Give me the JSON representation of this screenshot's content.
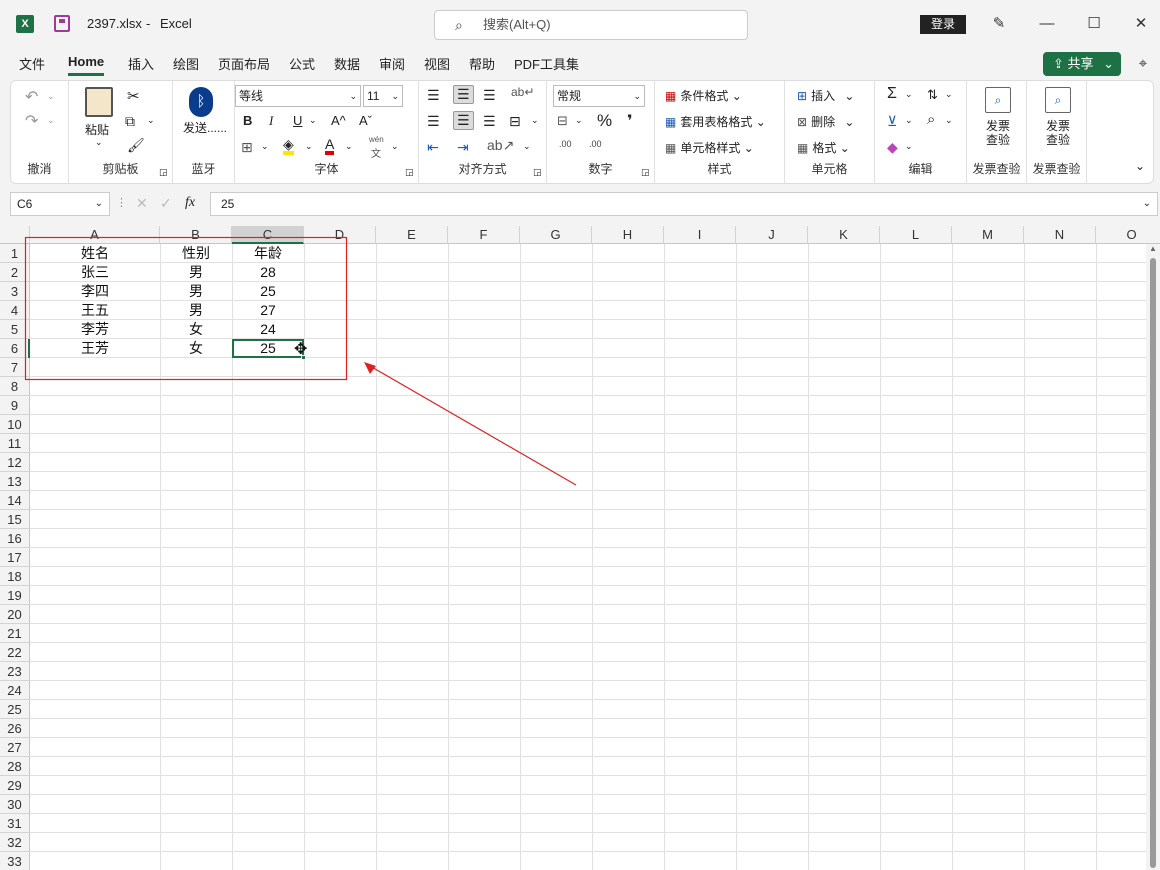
{
  "window": {
    "filename": "2397.xlsx",
    "sep": "-",
    "app": "Excel",
    "search_placeholder": "搜索(Alt+Q)",
    "login": "登录"
  },
  "menu": [
    "文件",
    "Home",
    "插入",
    "绘图",
    "页面布局",
    "公式",
    "数据",
    "审阅",
    "视图",
    "帮助",
    "PDF工具集"
  ],
  "share": "共享",
  "ribbon": {
    "undo_label": "撤消",
    "clipboard": {
      "paste": "粘贴",
      "label": "剪贴板"
    },
    "bluetooth": {
      "btn": "发送......",
      "label": "蓝牙"
    },
    "font": {
      "name": "等线",
      "size": "11",
      "bold": "B",
      "italic": "I",
      "underline": "U",
      "grow": "A^",
      "shrink": "Aˇ",
      "wen_top": "wén",
      "wen": "文",
      "label": "字体"
    },
    "align": {
      "label": "对齐方式"
    },
    "number": {
      "format": "常规",
      "percent": "%",
      "comma": "❜",
      "dec_inc": ".00",
      "dec_dec": ".00",
      "label": "数字"
    },
    "styles": {
      "cond": "条件格式",
      "table": "套用表格格式",
      "cell": "单元格样式",
      "label": "样式"
    },
    "cells": {
      "insert": "插入",
      "delete": "删除",
      "format": "格式",
      "label": "单元格"
    },
    "edit": {
      "sum": "Σ",
      "label": "编辑"
    },
    "invoice1": {
      "btn": "发票查验",
      "label": "发票查验"
    },
    "invoice2": {
      "btn": "发票查验",
      "label": "发票查验"
    }
  },
  "namebox": "C6",
  "fx": "fx",
  "formula": "25",
  "columns": [
    "A",
    "B",
    "C",
    "D",
    "E",
    "F",
    "G",
    "H",
    "I",
    "J",
    "K",
    "L",
    "M",
    "N",
    "O"
  ],
  "rows": [
    "1",
    "2",
    "3",
    "4",
    "5",
    "6",
    "7",
    "8",
    "9",
    "10",
    "11",
    "12",
    "13",
    "14",
    "15",
    "16",
    "17",
    "18",
    "19",
    "20",
    "21",
    "22",
    "23",
    "24",
    "25",
    "26",
    "27",
    "28",
    "29",
    "30",
    "31",
    "32",
    "33"
  ],
  "table": [
    [
      "姓名",
      "性别",
      "年龄"
    ],
    [
      "张三",
      "男",
      "28"
    ],
    [
      "李四",
      "男",
      "25"
    ],
    [
      "王五",
      "男",
      "27"
    ],
    [
      "李芳",
      "女",
      "24"
    ],
    [
      "王芳",
      "女",
      "25"
    ]
  ],
  "colors": {
    "accent": "#1e7145",
    "annotation": "#e02020"
  }
}
